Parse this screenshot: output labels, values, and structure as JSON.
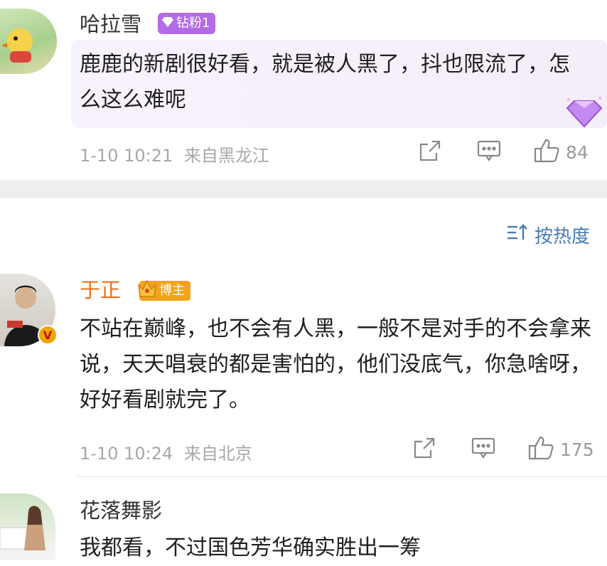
{
  "comments": [
    {
      "username": "哈拉雪",
      "badge": "钻粉1",
      "text": "鹿鹿的新剧很好看，就是被人黑了，抖也限流了，怎么这么难呢",
      "time": "1-10 10:21",
      "location": "来自黑龙江",
      "likes": "84"
    },
    {
      "username": "于正",
      "badge": "博主",
      "text": "不站在巅峰，也不会有人黑，一般不是对手的不会拿来说，天天唱衰的都是害怕的，他们没底气，你急啥呀，好好看剧就完了。",
      "time": "1-10 10:24",
      "location": "来自北京",
      "likes": "175",
      "verified_badge": "V"
    },
    {
      "username": "花落舞影",
      "text": "我都看，不过国色芳华确实胜出一筹"
    }
  ],
  "sort": {
    "label": "按热度"
  },
  "colors": {
    "highlight_bg": "#f6f0fa",
    "separator": "#eeeeee",
    "blogger_name": "#e8741d",
    "link_blue": "#4a7bb8",
    "diamond_badge": "#b46be6"
  },
  "icons": [
    "diamond-icon",
    "share-icon",
    "comment-icon",
    "like-icon",
    "sort-icon",
    "crown-icon",
    "verified-icon"
  ]
}
